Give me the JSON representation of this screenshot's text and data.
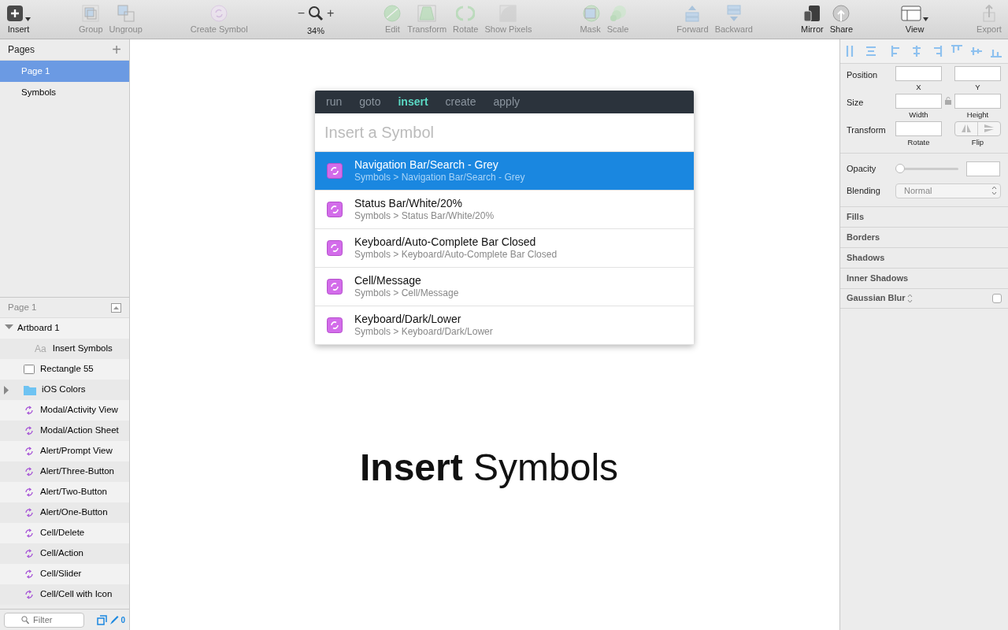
{
  "toolbar": {
    "groups": [
      [
        {
          "kind": "button",
          "label": "Insert",
          "disabled": false,
          "caret": true
        }
      ],
      [
        {
          "kind": "button",
          "label": "Group",
          "disabled": true
        },
        {
          "kind": "button",
          "label": "Ungroup",
          "disabled": true
        }
      ],
      [
        {
          "kind": "button",
          "label": "Create Symbol",
          "disabled": true
        }
      ],
      [
        {
          "kind": "zoom",
          "minus": "−",
          "plus": "+",
          "label": "34%"
        }
      ],
      [
        {
          "kind": "button",
          "label": "Edit",
          "disabled": true
        },
        {
          "kind": "button",
          "label": "Transform",
          "disabled": true
        },
        {
          "kind": "button",
          "label": "Rotate",
          "disabled": true
        },
        {
          "kind": "button",
          "label": "Show Pixels",
          "disabled": true
        }
      ],
      [
        {
          "kind": "button",
          "label": "Mask",
          "disabled": true
        },
        {
          "kind": "button",
          "label": "Scale",
          "disabled": true
        }
      ],
      [
        {
          "kind": "button",
          "label": "Forward",
          "disabled": true
        },
        {
          "kind": "button",
          "label": "Backward",
          "disabled": true
        }
      ],
      [
        {
          "kind": "button",
          "label": "Mirror",
          "disabled": false
        },
        {
          "kind": "button",
          "label": "Share",
          "disabled": false
        }
      ],
      [
        {
          "kind": "button",
          "label": "View",
          "disabled": false,
          "caret": true
        }
      ],
      [
        {
          "kind": "button",
          "label": "Export",
          "disabled": true
        }
      ]
    ]
  },
  "pages": {
    "title": "Pages",
    "add": "+",
    "items": [
      {
        "label": "Page 1",
        "selected": true
      },
      {
        "label": "Symbols",
        "selected": false
      }
    ]
  },
  "layers": {
    "title": "Page 1",
    "items": [
      {
        "label": "Artboard 1",
        "expanded": true,
        "children": [
          {
            "kind": "text",
            "badge": "Aa",
            "label": "Insert Symbols"
          },
          {
            "kind": "rectangle",
            "label": "Rectangle 55"
          },
          {
            "kind": "folder",
            "label": "iOS Colors",
            "expanded": false
          },
          {
            "kind": "symbol",
            "label": "Modal/Activity View"
          },
          {
            "kind": "symbol",
            "label": "Modal/Action Sheet"
          },
          {
            "kind": "symbol",
            "label": "Alert/Prompt View"
          },
          {
            "kind": "symbol",
            "label": "Alert/Three-Button"
          },
          {
            "kind": "symbol",
            "label": "Alert/Two-Button"
          },
          {
            "kind": "symbol",
            "label": "Alert/One-Button"
          },
          {
            "kind": "symbol",
            "label": "Cell/Delete"
          },
          {
            "kind": "symbol",
            "label": "Cell/Action"
          },
          {
            "kind": "symbol",
            "label": "Cell/Slider"
          },
          {
            "kind": "symbol",
            "label": "Cell/Cell with Icon"
          }
        ]
      }
    ]
  },
  "filter": {
    "placeholder": "Filter",
    "count": "0"
  },
  "palette": {
    "tabs": [
      {
        "label": "run",
        "selected": false
      },
      {
        "label": "goto",
        "selected": false
      },
      {
        "label": "insert",
        "selected": true
      },
      {
        "label": "create",
        "selected": false
      },
      {
        "label": "apply",
        "selected": false
      }
    ],
    "placeholder": "Insert a Symbol",
    "results": [
      {
        "title": "Navigation Bar/Search - Grey",
        "path": "Symbols > Navigation Bar/Search - Grey",
        "selected": true
      },
      {
        "title": "Status Bar/White/20%",
        "path": "Symbols > Status Bar/White/20%",
        "selected": false
      },
      {
        "title": "Keyboard/Auto-Complete Bar Closed",
        "path": "Symbols > Keyboard/Auto-Complete Bar Closed",
        "selected": false
      },
      {
        "title": "Cell/Message",
        "path": "Symbols > Cell/Message",
        "selected": false
      },
      {
        "title": "Keyboard/Dark/Lower",
        "path": "Symbols > Keyboard/Dark/Lower",
        "selected": false
      }
    ]
  },
  "canvas_heading": "**Insert** Symbols",
  "inspector": {
    "rows": [
      {
        "label": "Position",
        "fields": [
          {
            "caption": "X"
          },
          {
            "caption": "Y"
          }
        ],
        "lock": false
      },
      {
        "label": "Size",
        "fields": [
          {
            "caption": "Width"
          },
          {
            "caption": "Height"
          }
        ],
        "lock": true
      },
      {
        "label": "Transform",
        "fields": [
          {
            "caption": "Rotate"
          }
        ],
        "flip": "Flip"
      }
    ],
    "opacity": {
      "label": "Opacity",
      "level": 0
    },
    "blending": {
      "label": "Blending",
      "value": "Normal"
    },
    "sections": [
      {
        "label": "Fills"
      },
      {
        "label": "Borders"
      },
      {
        "label": "Shadows"
      },
      {
        "label": "Inner Shadows"
      },
      {
        "label": "Gaussian Blur",
        "stepper": true,
        "checked": false
      }
    ]
  }
}
